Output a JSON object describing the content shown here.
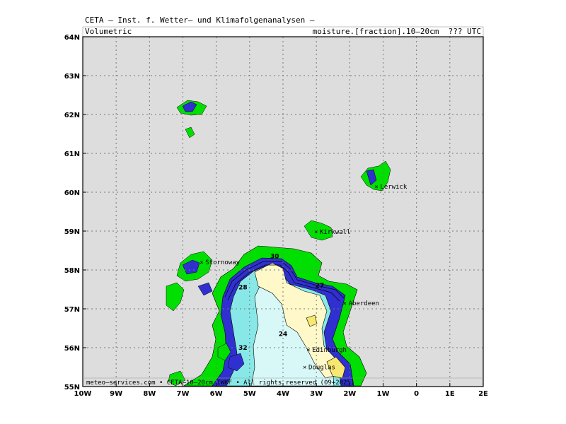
{
  "header": {
    "line1": "CETA — Inst. f. Wetter— und Klimafolgenanalysen —",
    "left": "Volumetric",
    "right": "moisture.[fraction].10—20cm  ??? UTC"
  },
  "map": {
    "lon_range": [
      -10,
      2
    ],
    "lat_range": [
      55,
      64
    ],
    "x_ticks": [
      "10W",
      "9W",
      "8W",
      "7W",
      "6W",
      "5W",
      "4W",
      "3W",
      "2W",
      "1W",
      "0",
      "1E",
      "2E"
    ],
    "y_ticks": [
      "55N",
      "56N",
      "57N",
      "58N",
      "59N",
      "60N",
      "61N",
      "62N",
      "63N",
      "64N"
    ],
    "cities": [
      {
        "name": "Lerwick",
        "lon": -1.15,
        "lat": 60.15
      },
      {
        "name": "Kirkwall",
        "lon": -2.96,
        "lat": 58.98
      },
      {
        "name": "Stornoway",
        "lon": -6.39,
        "lat": 58.2
      },
      {
        "name": "Aberdeen",
        "lon": -2.1,
        "lat": 57.15
      },
      {
        "name": "Edinburgh",
        "lon": -3.19,
        "lat": 55.95
      },
      {
        "name": "Douglas",
        "lon": -3.3,
        "lat": 55.5
      }
    ],
    "contour_labels": [
      {
        "text": "30",
        "lon": -4.25,
        "lat": 58.3
      },
      {
        "text": "28",
        "lon": -5.2,
        "lat": 57.5
      },
      {
        "text": "27",
        "lon": -2.9,
        "lat": 57.55
      },
      {
        "text": "24",
        "lon": -4.0,
        "lat": 56.3
      },
      {
        "text": "32",
        "lon": -5.2,
        "lat": 55.95
      }
    ],
    "colors": {
      "background": "#dddddd",
      "land_wet": "#00e000",
      "high_moisture": "#3030d0",
      "mid_moisture": "#88e8e8",
      "low_moisture": "#d8f8f8",
      "dry": "#fff8c8",
      "driest": "#f8e870"
    }
  },
  "footer": {
    "credit": "meteo—services.com • CETA—10—20cm IWKF • All rights reserved (09+2025)"
  }
}
